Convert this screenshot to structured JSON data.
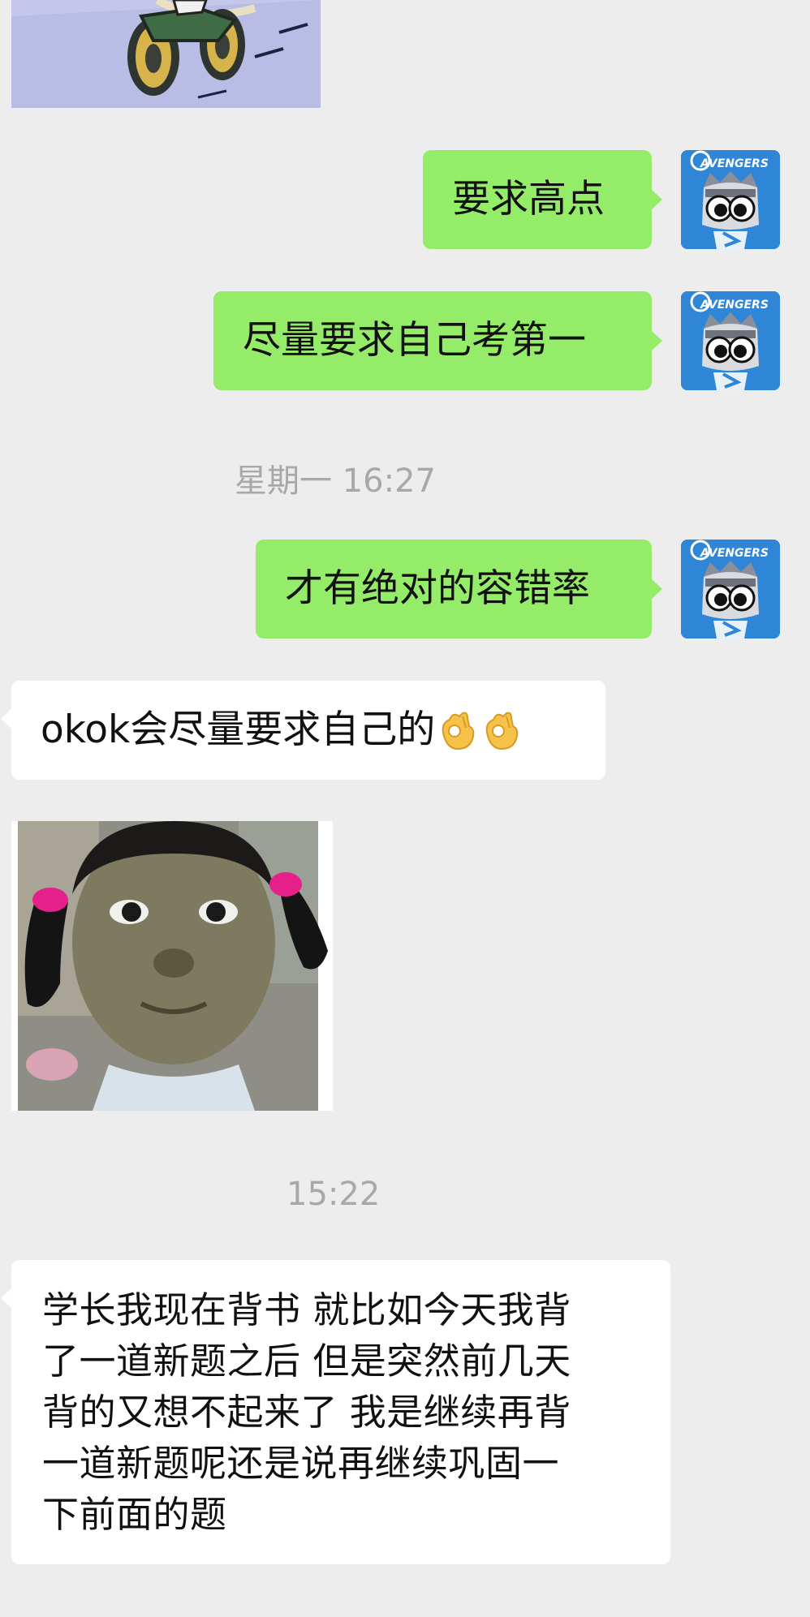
{
  "messages": {
    "m1": "要求高点",
    "m2": "尽量要求自己考第一",
    "m3": "才有绝对的容错率",
    "m4": "okok会尽量要求自己的",
    "m5_lines": [
      "学长我现在背书 就比如今天我背",
      "了一道新题之后 但是突然前几天",
      "背的又想不起来了 我是继续再背",
      "一道新题呢还是说再继续巩固一",
      "下前面的题"
    ]
  },
  "timestamps": {
    "t1": "星期一 16:27",
    "t2": "15:22"
  },
  "avatar": {
    "logo_text": "AVENGERS"
  },
  "icons": {
    "ok_hand": "ok-hand-emoji"
  },
  "colors": {
    "background": "#ededed",
    "outgoing_bubble": "#95ec69",
    "incoming_bubble": "#ffffff",
    "avatar_bg": "#2f86d6",
    "timestamp": "#a8a8a8"
  }
}
